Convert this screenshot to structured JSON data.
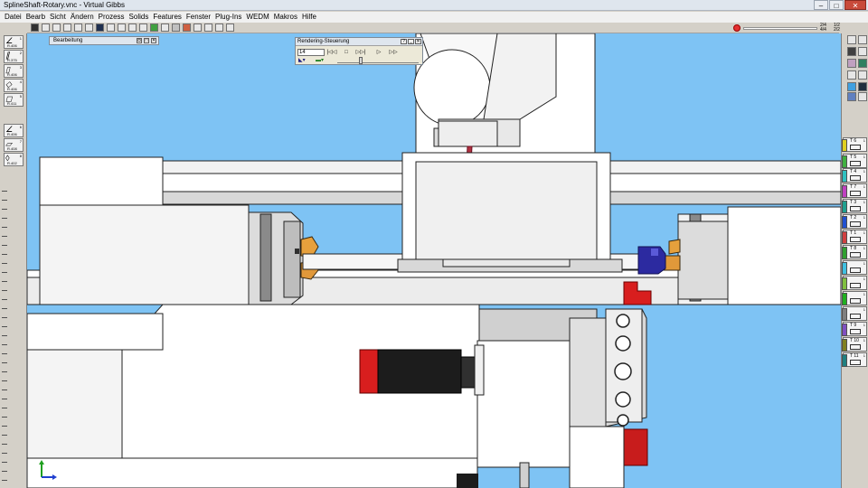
{
  "window": {
    "title": "SplineShaft-Rotary.vnc - Virtual Gibbs",
    "buttons": {
      "minimize": "–",
      "maximize": "□",
      "close": "✕"
    }
  },
  "menu": {
    "items": [
      "Datei",
      "Bearb",
      "Sicht",
      "Ändern",
      "Prozess",
      "Solids",
      "Features",
      "Fenster",
      "Plug-Ins",
      "WEDM",
      "Makros",
      "Hilfe"
    ]
  },
  "toolbar": {
    "status_a": [
      "2/4",
      "4/4"
    ],
    "status_b": [
      "1/2",
      "2/2"
    ]
  },
  "left_palette": {
    "tools": [
      {
        "label": "R.406",
        "num": "1"
      },
      {
        "label": "R.375",
        "num": "2"
      },
      {
        "label": "R.406",
        "num": "3"
      },
      {
        "label": "R.406",
        "num": "4"
      },
      {
        "label": "R.411",
        "num": "5"
      },
      {
        "label": "R.406",
        "num": "6"
      },
      {
        "label": "R.408",
        "num": "7"
      },
      {
        "label": "R.402",
        "num": "8"
      }
    ]
  },
  "bearbeitung_panel": {
    "title": "Bearbeitung",
    "buttons": [
      "◘",
      "□",
      "✕"
    ]
  },
  "render_panel": {
    "title": "Rendering-Steuerung",
    "buttons": [
      "?",
      "_",
      "✕"
    ],
    "frame_value": "14",
    "controls": [
      "|◁◁",
      "□",
      "▷▷|",
      "▷",
      "▷▷"
    ]
  },
  "tool_tabs": [
    {
      "label": "T 6",
      "color": "#e0d020"
    },
    {
      "label": "T 5",
      "color": "#40b040"
    },
    {
      "label": "T 4",
      "color": "#30c0c0"
    },
    {
      "label": "T 7",
      "color": "#c040c0"
    },
    {
      "label": "T 3",
      "color": "#20a090"
    },
    {
      "label": "T 2",
      "color": "#2050d0"
    },
    {
      "label": "T 1",
      "color": "#d04040"
    },
    {
      "label": "T 8",
      "color": "#30a030"
    },
    {
      "label": "",
      "color": "#40c0e0"
    },
    {
      "label": "",
      "color": "#80c040"
    },
    {
      "label": "",
      "color": "#20b020"
    },
    {
      "label": "",
      "color": "#808080"
    },
    {
      "label": "T 9",
      "color": "#8050c0"
    },
    {
      "label": "T 10",
      "color": "#808020"
    },
    {
      "label": "T 11",
      "color": "#208080"
    }
  ],
  "tool_tab_num": "1"
}
